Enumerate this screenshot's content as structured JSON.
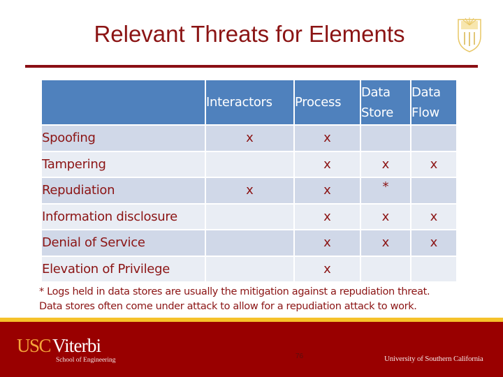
{
  "slide": {
    "title": "Relevant Threats for Elements",
    "seal_icon": "usc-seal-icon",
    "accent_color": "#8b0f14"
  },
  "table": {
    "columns": [
      "",
      "Interactors",
      "Process",
      "Data Store",
      "Data Flow"
    ],
    "header_lines": {
      "interactors": "Interactors",
      "process": "Process",
      "data_store_1": "Data",
      "data_store_2": "Store",
      "data_flow_1": "Data",
      "data_flow_2": "Flow"
    },
    "rows": [
      {
        "threat": "Spoofing",
        "interactors": "x",
        "process": "x",
        "data_store": "",
        "data_flow": ""
      },
      {
        "threat": "Tampering",
        "interactors": "",
        "process": "x",
        "data_store": "x",
        "data_flow": "x"
      },
      {
        "threat": "Repudiation",
        "interactors": "x",
        "process": "x",
        "data_store": "*",
        "data_flow": ""
      },
      {
        "threat": "Information disclosure",
        "interactors": "",
        "process": "x",
        "data_store": "x",
        "data_flow": "x"
      },
      {
        "threat": "Denial of Service",
        "interactors": "",
        "process": "x",
        "data_store": "x",
        "data_flow": "x"
      },
      {
        "threat": "Elevation of Privilege",
        "interactors": "",
        "process": "x",
        "data_store": "",
        "data_flow": ""
      }
    ],
    "header_color": "#4f81bd",
    "row_odd_color": "#d0d8e8",
    "row_even_color": "#e9edf4"
  },
  "footnote": {
    "line1": "* Logs held in data stores are usually the mitigation against a repudiation threat.",
    "line2": "Data stores often come under attack to allow for a repudiation attack to work."
  },
  "footer": {
    "logo_usc": "USC",
    "logo_viterbi": "Viterbi",
    "logo_school": "School of Engineering",
    "page_number": "76",
    "university": "University of Southern California",
    "background_color": "#990000",
    "gold_color": "#f5c22b"
  }
}
